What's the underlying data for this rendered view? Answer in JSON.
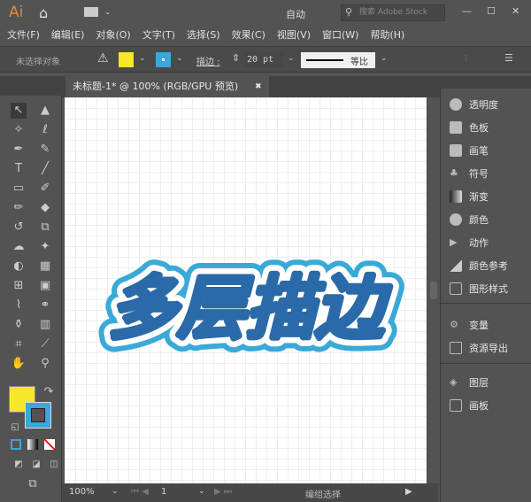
{
  "titlebar": {
    "logo": "Ai",
    "workspace": "自动",
    "search_placeholder": "搜索 Adobe Stock",
    "minimize": "—",
    "maximize": "☐",
    "close": "✕"
  },
  "menu": [
    "文件(F)",
    "编辑(E)",
    "对象(O)",
    "文字(T)",
    "选择(S)",
    "效果(C)",
    "视图(V)",
    "窗口(W)",
    "帮助(H)"
  ],
  "control": {
    "selection": "未选择对象",
    "fill_color": "#f7e62d",
    "stroke_color": "#3ba7dc",
    "stroke_label": "描边 :",
    "stroke_value": "20 pt",
    "profile": "等比"
  },
  "tab": {
    "title": "未标题-1* @ 100% (RGB/GPU 预览)",
    "close": "✖"
  },
  "artwork": {
    "text": "多层描边",
    "fill": "#f7ec2e",
    "inner_stroke": "#2b6aa8",
    "outer_stroke": "#3aa9d8"
  },
  "tools": {
    "fill": "#f7e62d",
    "stroke": "#3ba7dc"
  },
  "panels": [
    {
      "label": "透明度",
      "icon": "transparency-icon"
    },
    {
      "label": "色板",
      "icon": "swatches-icon"
    },
    {
      "label": "画笔",
      "icon": "brush-icon"
    },
    {
      "label": "符号",
      "icon": "symbol-icon"
    },
    {
      "label": "渐变",
      "icon": "gradient-icon"
    },
    {
      "label": "颜色",
      "icon": "color-icon"
    },
    {
      "label": "动作",
      "icon": "action-icon"
    },
    {
      "label": "颜色参考",
      "icon": "color-guide-icon"
    },
    {
      "label": "图形样式",
      "icon": "graphic-styles-icon"
    },
    {
      "label": "变量",
      "icon": "variables-icon"
    },
    {
      "label": "资源导出",
      "icon": "asset-export-icon"
    },
    {
      "label": "图层",
      "icon": "layers-icon"
    },
    {
      "label": "画板",
      "icon": "artboards-icon"
    }
  ],
  "status": {
    "zoom": "100%",
    "page": "1",
    "mode": "编组选择"
  }
}
